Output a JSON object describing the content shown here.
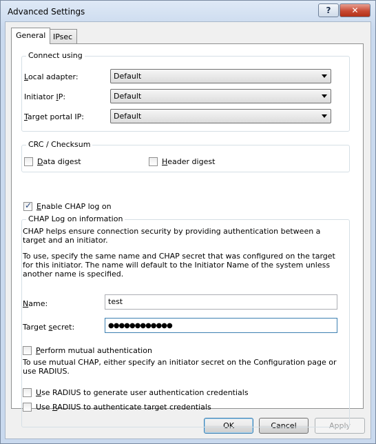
{
  "window": {
    "title": "Advanced Settings",
    "help_glyph": "?",
    "close_glyph": "✕"
  },
  "tabs": [
    {
      "label": "General",
      "selected": true
    },
    {
      "label": "IPsec",
      "selected": false
    }
  ],
  "connect_using": {
    "title": "Connect using",
    "local_adapter": {
      "label": "Local adapter:",
      "value": "Default"
    },
    "initiator_ip": {
      "label": "Initiator IP:",
      "value": "Default"
    },
    "target_portal_ip": {
      "label": "Target portal IP:",
      "value": "Default"
    }
  },
  "crc": {
    "title": "CRC / Checksum",
    "data_digest": {
      "label": "Data digest",
      "checked": false
    },
    "header_digest": {
      "label": "Header digest",
      "checked": false
    }
  },
  "enable_chap": {
    "label": "Enable CHAP log on",
    "checked": true
  },
  "chap": {
    "title": "CHAP Log on information",
    "desc1": "CHAP helps ensure connection security by providing authentication between a target and an initiator.",
    "desc2": "To use, specify the same name and CHAP secret that was configured on the target for this initiator.  The name will default to the Initiator Name of the system unless another name is specified.",
    "name": {
      "label": "Name:",
      "value": "test"
    },
    "secret": {
      "label": "Target secret:",
      "value": "●●●●●●●●●●●●"
    },
    "mutual": {
      "label": "Perform mutual authentication",
      "checked": false
    },
    "mutual_desc": "To use mutual CHAP, either specify an initiator secret on the Configuration page or use RADIUS.",
    "radius_user": {
      "label": "Use RADIUS to generate user authentication credentials",
      "checked": false
    },
    "radius_target": {
      "label": "Use RADIUS to authenticate target credentials",
      "checked": false
    }
  },
  "buttons": {
    "ok": "OK",
    "cancel": "Cancel",
    "apply": "Apply"
  }
}
